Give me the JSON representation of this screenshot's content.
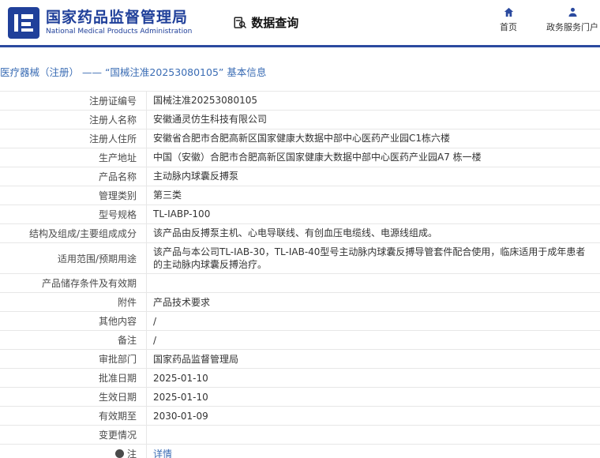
{
  "header": {
    "org_name_zh": "国家药品监督管理局",
    "org_name_en": "National Medical Products Administration",
    "section_title": "数据查询",
    "nav": [
      {
        "label": "首页",
        "icon": "home-icon"
      },
      {
        "label": "政务服务门户",
        "icon": "user-icon"
      }
    ]
  },
  "breadcrumb": {
    "text": "医疗器械（注册） —— “国械注准20253080105” 基本信息"
  },
  "colors": {
    "brand_blue": "#20409a",
    "divider_blue": "#2b4a9f",
    "link_blue": "#3a6cb4",
    "border_gray": "#e7e7e7"
  },
  "table": {
    "rows": [
      {
        "label": "注册证编号",
        "value": "国械注准20253080105"
      },
      {
        "label": "注册人名称",
        "value": "安徽通灵仿生科技有限公司"
      },
      {
        "label": "注册人住所",
        "value": "安徽省合肥市合肥高新区国家健康大数据中部中心医药产业园C1栋六楼"
      },
      {
        "label": "生产地址",
        "value": "中国（安徽）合肥市合肥高新区国家健康大数据中部中心医药产业园A7 栋一楼"
      },
      {
        "label": "产品名称",
        "value": "主动脉内球囊反搏泵"
      },
      {
        "label": "管理类别",
        "value": "第三类"
      },
      {
        "label": "型号规格",
        "value": "TL-IABP-100"
      },
      {
        "label": "结构及组成/主要组成成分",
        "value": "该产品由反搏泵主机、心电导联线、有创血压电缆线、电源线组成。"
      },
      {
        "label": "适用范围/预期用途",
        "value": "该产品与本公司TL-IAB-30，TL-IAB-40型号主动脉内球囊反搏导管套件配合使用，临床适用于成年患者的主动脉内球囊反搏治疗。"
      },
      {
        "label": "产品储存条件及有效期",
        "value": ""
      },
      {
        "label": "附件",
        "value": "产品技术要求"
      },
      {
        "label": "其他内容",
        "value": "/"
      },
      {
        "label": "备注",
        "value": "/"
      },
      {
        "label": "审批部门",
        "value": "国家药品监督管理局"
      },
      {
        "label": "批准日期",
        "value": "2025-01-10"
      },
      {
        "label": "生效日期",
        "value": "2025-01-10"
      },
      {
        "label": "有效期至",
        "value": "2030-01-09"
      },
      {
        "label": "变更情况",
        "value": ""
      },
      {
        "label": "注",
        "value": "详情",
        "link": true,
        "icon": "note-icon"
      }
    ]
  }
}
